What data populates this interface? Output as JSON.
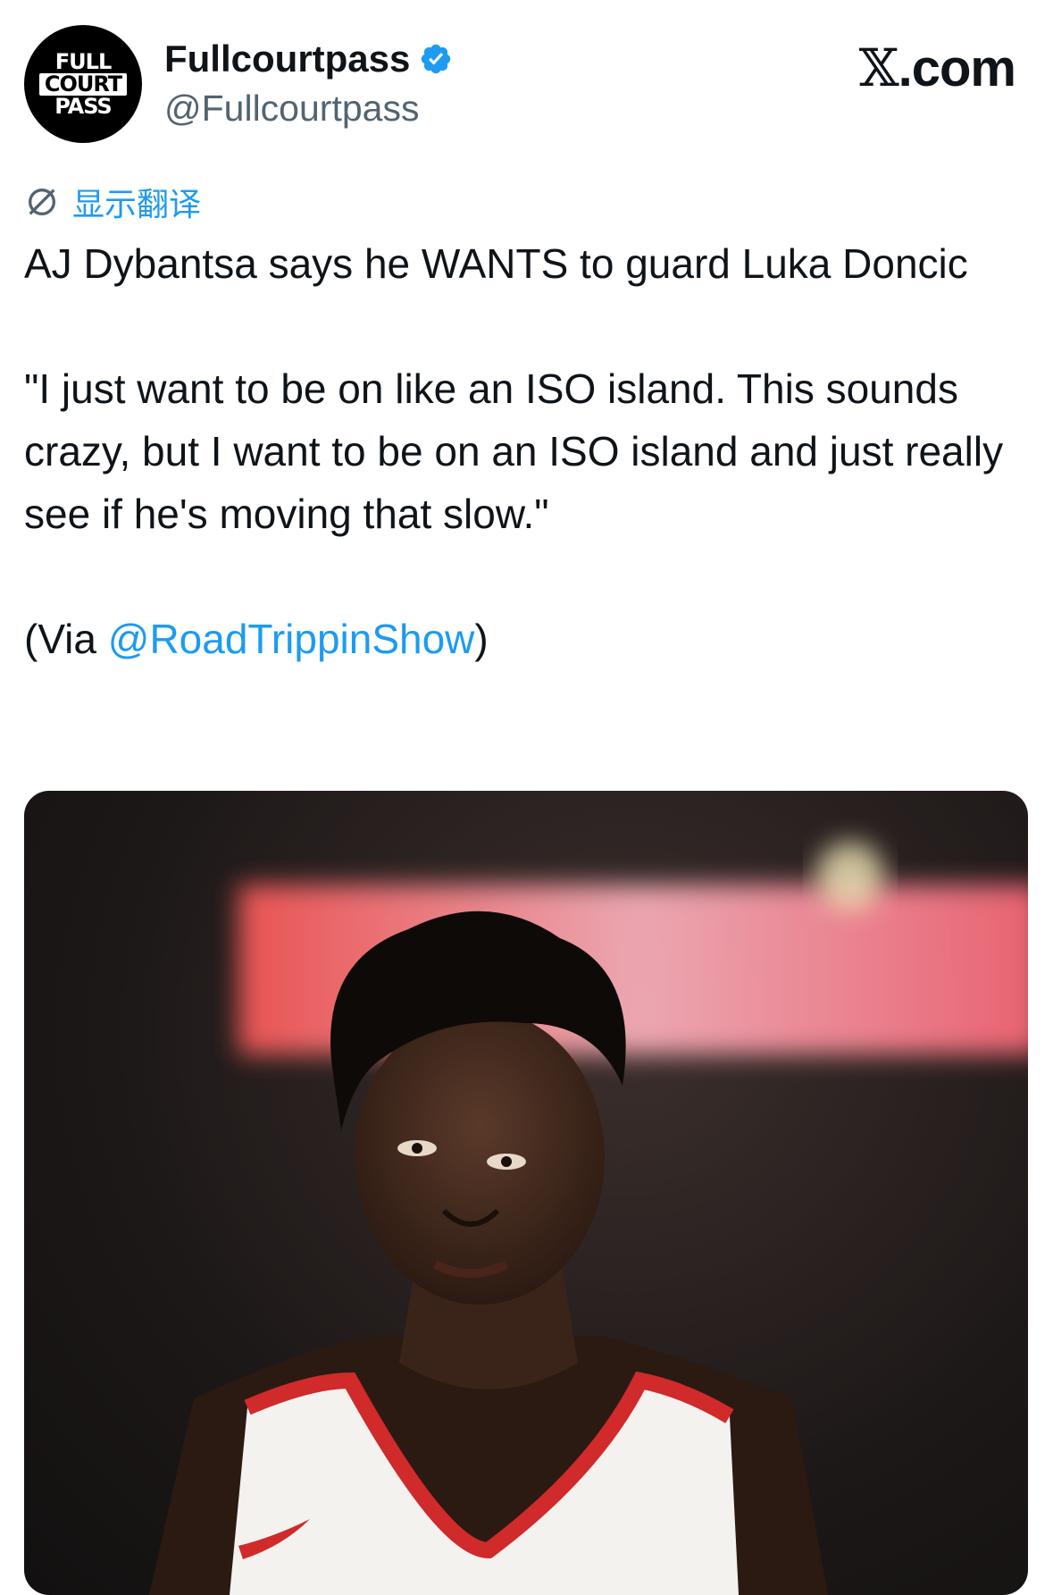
{
  "account": {
    "avatar_lines": [
      "FULL",
      "COURT",
      "PASS"
    ],
    "display_name": "Fullcourtpass",
    "handle": "@Fullcourtpass",
    "verified": true
  },
  "site_label": {
    "x": "𝕏",
    "rest": ".com"
  },
  "translate_label": "显示翻译",
  "tweet": {
    "line1": "AJ Dybantsa says he WANTS to guard Luka Doncic",
    "quote": "\"I just want to be on like an ISO island. This sounds crazy, but I want to be on an ISO island and just really see if he's moving that slow.\"",
    "via_prefix": "(Via ",
    "via_mention": "@RoadTrippinShow",
    "via_suffix": ")"
  },
  "colors": {
    "link": "#1d9bf0",
    "text": "#0f1419",
    "secondary": "#536471"
  },
  "icons": [
    "verified-badge-icon",
    "globe-icon"
  ]
}
